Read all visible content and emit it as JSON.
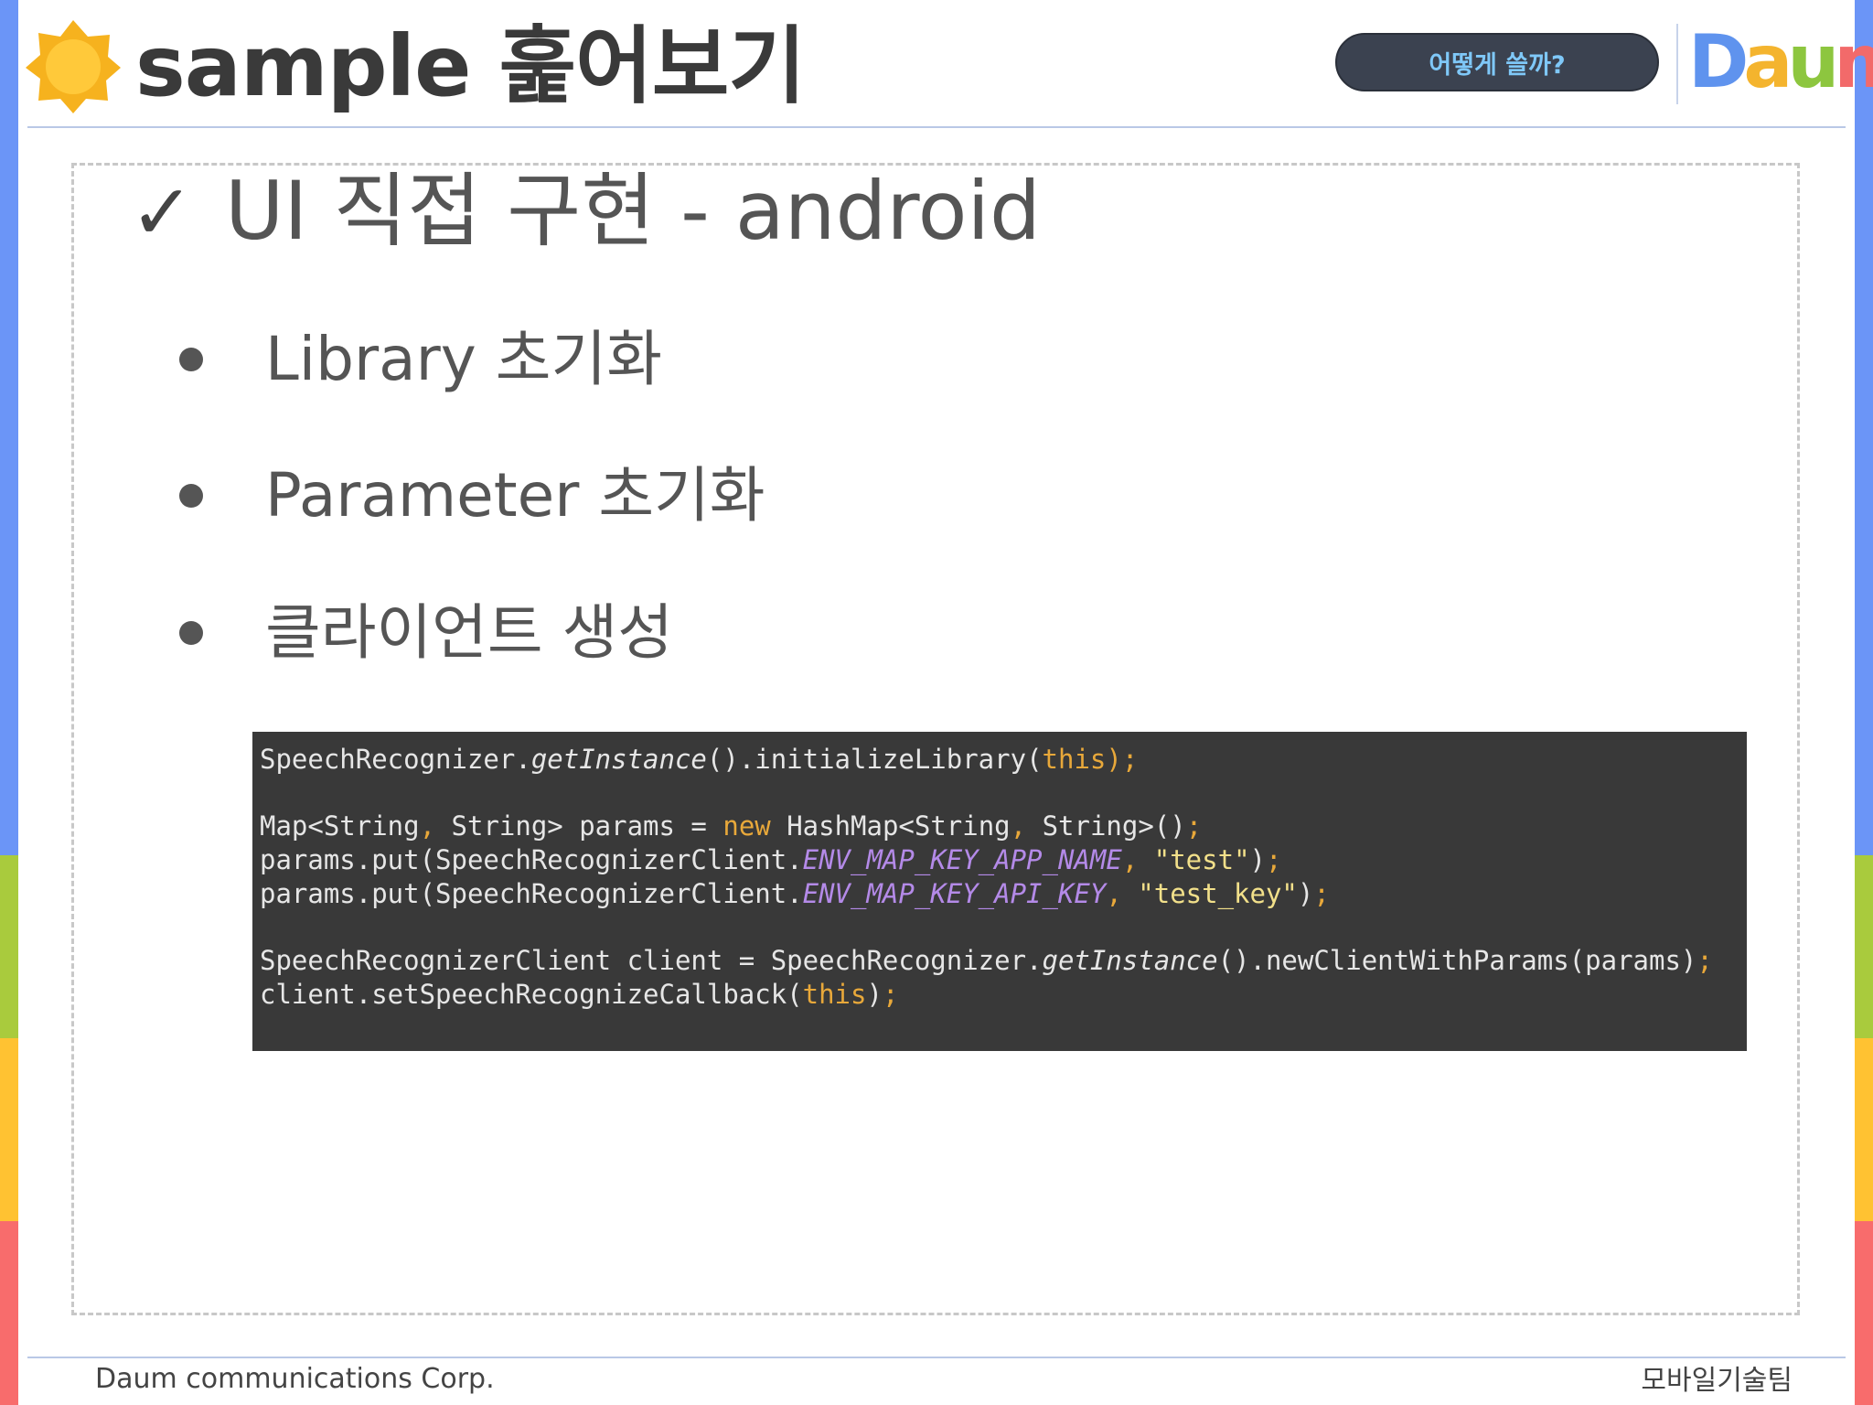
{
  "colors": {
    "side_blue": "#6b95f7",
    "side_green": "#a9cb3d",
    "side_yellow": "#ffc232",
    "side_red": "#f86c6c",
    "rule": "#b9c8e6",
    "pill_bg": "#3b4250",
    "pill_text": "#7fc8f8",
    "code_bg": "#393939",
    "logo_blue": "#5f93ee",
    "logo_yellow": "#f4b42e",
    "logo_green": "#8dc63f",
    "logo_pink": "#f26a6a"
  },
  "header": {
    "icon": "sun-icon",
    "title": "sample 훑어보기",
    "pill_label": "어떻게 쓸까?",
    "logo_letters": [
      "D",
      "a",
      "u",
      "m"
    ]
  },
  "main": {
    "heading_check": "✓",
    "heading": "UI 직접 구현 - android",
    "bullets": [
      "Library 초기화",
      "Parameter 초기화",
      "클라이언트 생성"
    ]
  },
  "code": {
    "lines": [
      [
        {
          "t": "SpeechRecognizer."
        },
        {
          "t": "getInstance",
          "c": "it"
        },
        {
          "t": "().initializeLibrary("
        },
        {
          "t": "this",
          "c": "kw"
        },
        {
          "t": ");",
          "c": "kw"
        }
      ],
      [],
      [
        {
          "t": "Map<String"
        },
        {
          "t": ",",
          "c": "kw"
        },
        {
          "t": " String> params = "
        },
        {
          "t": "new",
          "c": "kw"
        },
        {
          "t": " HashMap<String"
        },
        {
          "t": ",",
          "c": "kw"
        },
        {
          "t": " String>()"
        },
        {
          "t": ";",
          "c": "kw"
        }
      ],
      [
        {
          "t": "params.put(SpeechRecognizerClient."
        },
        {
          "t": "ENV_MAP_KEY_APP_NAME",
          "c": "const"
        },
        {
          "t": ",",
          "c": "kw"
        },
        {
          "t": " "
        },
        {
          "t": "\"test\"",
          "c": "str"
        },
        {
          "t": ")"
        },
        {
          "t": ";",
          "c": "kw"
        }
      ],
      [
        {
          "t": "params.put(SpeechRecognizerClient."
        },
        {
          "t": "ENV_MAP_KEY_API_KEY",
          "c": "const"
        },
        {
          "t": ",",
          "c": "kw"
        },
        {
          "t": " "
        },
        {
          "t": "\"test_key\"",
          "c": "str"
        },
        {
          "t": ")"
        },
        {
          "t": ";",
          "c": "kw"
        }
      ],
      [],
      [
        {
          "t": "SpeechRecognizerClient client = SpeechRecognizer."
        },
        {
          "t": "getInstance",
          "c": "it"
        },
        {
          "t": "().newClientWithParams(params)"
        },
        {
          "t": ";",
          "c": "kw"
        }
      ],
      [
        {
          "t": "client.setSpeechRecognizeCallback("
        },
        {
          "t": "this",
          "c": "kw"
        },
        {
          "t": ")"
        },
        {
          "t": ";",
          "c": "kw"
        }
      ]
    ]
  },
  "footer": {
    "left": "Daum communications Corp.",
    "right": "모바일기술팀"
  }
}
